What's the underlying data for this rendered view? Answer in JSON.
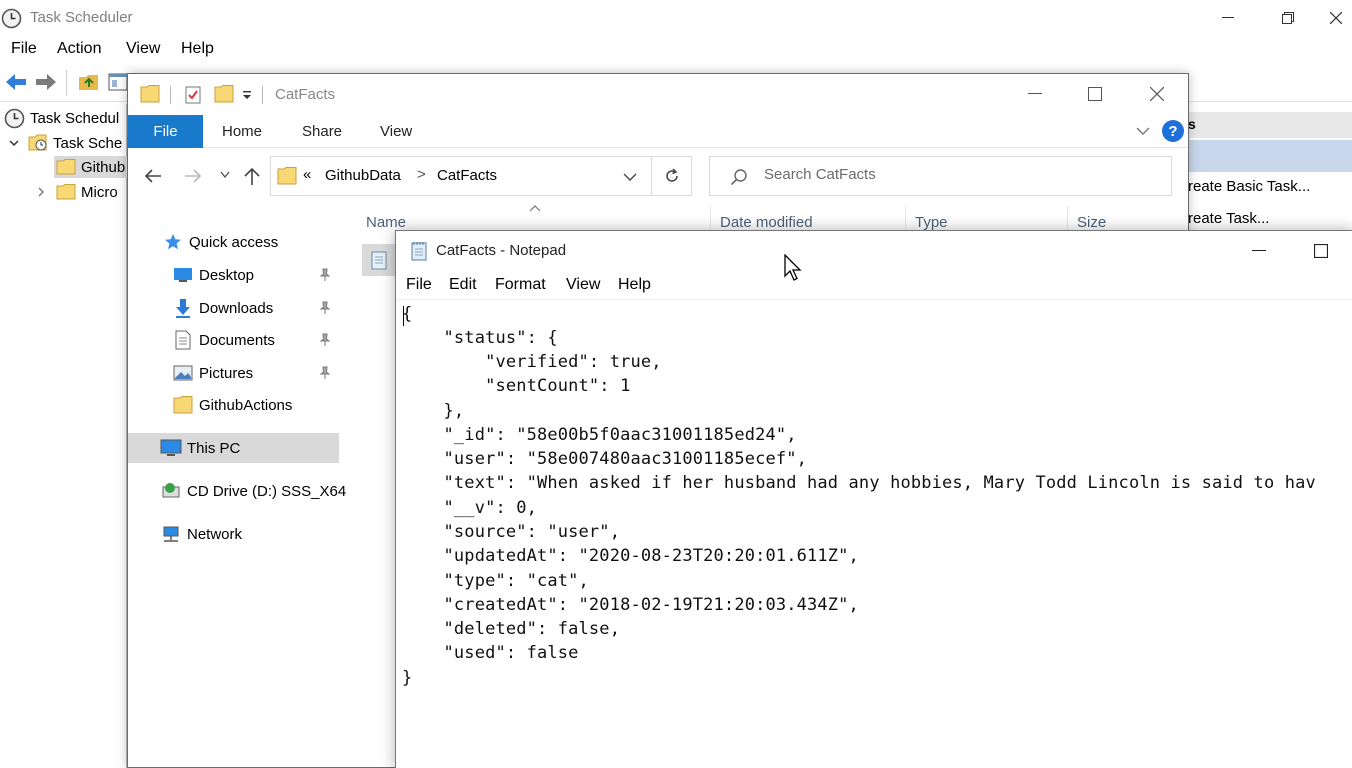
{
  "task_scheduler": {
    "title": "Task Scheduler",
    "menu": [
      "File",
      "Action",
      "View",
      "Help"
    ],
    "tree": [
      {
        "label": "Task Scheduler (Local)",
        "shown": "Task Schedul"
      },
      {
        "label": "Task Scheduler Library",
        "shown": "Task Sche"
      },
      {
        "label": "GithubData",
        "shown": "Github"
      },
      {
        "label": "Microsoft",
        "shown": "Micro"
      }
    ],
    "actions_header": "s",
    "actions": [
      "reate Basic Task...",
      "reate Task..."
    ]
  },
  "explorer": {
    "title": "CatFacts",
    "ribbon_tabs": [
      "File",
      "Home",
      "Share",
      "View"
    ],
    "breadcrumb": {
      "overflow": "«",
      "parts": [
        "GithubData",
        "CatFacts"
      ],
      "separator": ">"
    },
    "search_placeholder": "Search CatFacts",
    "nav": {
      "quick_access": "Quick access",
      "items": [
        "Desktop",
        "Downloads",
        "Documents",
        "Pictures",
        "GithubActions"
      ],
      "this_pc": "This PC",
      "cd_drive": "CD Drive (D:) SSS_X64",
      "network": "Network"
    },
    "columns": [
      "Name",
      "Date modified",
      "Type",
      "Size"
    ]
  },
  "notepad": {
    "title": "CatFacts - Notepad",
    "menu": [
      "File",
      "Edit",
      "Format",
      "View",
      "Help"
    ],
    "lines": [
      "{",
      "    \"status\": {",
      "        \"verified\": true,",
      "        \"sentCount\": 1",
      "    },",
      "    \"_id\": \"58e00b5f0aac31001185ed24\",",
      "    \"user\": \"58e007480aac31001185ecef\",",
      "    \"text\": \"When asked if her husband had any hobbies, Mary Todd Lincoln is said to hav",
      "    \"__v\": 0,",
      "    \"source\": \"user\",",
      "    \"updatedAt\": \"2020-08-23T20:20:01.611Z\",",
      "    \"type\": \"cat\",",
      "    \"createdAt\": \"2018-02-19T21:20:03.434Z\",",
      "    \"deleted\": false,",
      "    \"used\": false",
      "}"
    ]
  },
  "colors": {
    "ribbon_file": "#1979ca",
    "folder": "#f8d775",
    "help_badge": "#1e6fd9",
    "selection": "#d9d9d9"
  }
}
